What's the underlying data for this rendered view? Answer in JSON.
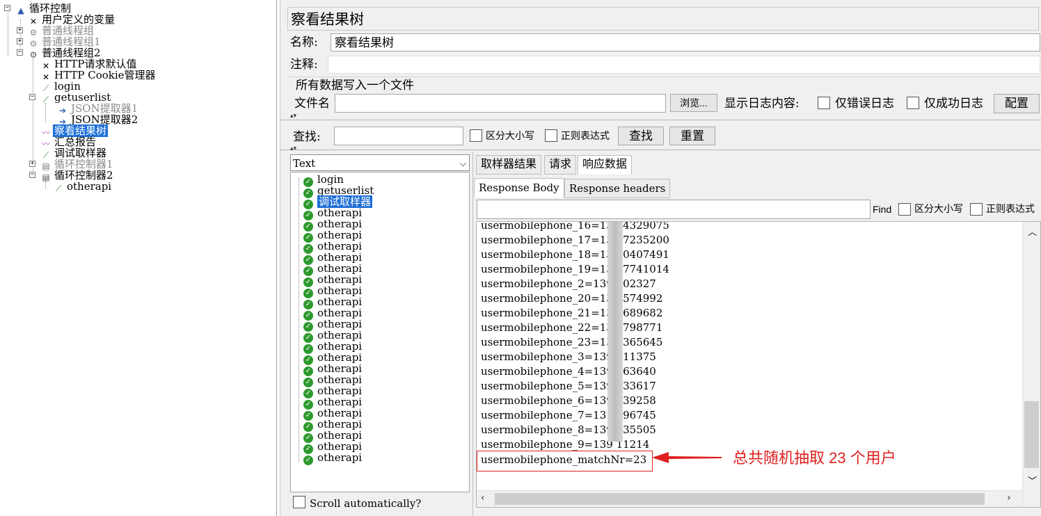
{
  "tree": {
    "root": "循环控制",
    "items": [
      {
        "label": "用户定义的变量",
        "icon": "wrench-icon"
      },
      {
        "label": "普通线程组",
        "icon": "gear-icon"
      },
      {
        "label": "普通线程组1",
        "icon": "gear-icon"
      },
      {
        "label": "普通线程组2",
        "icon": "gear-icon"
      },
      {
        "label": "HTTP请求默认值",
        "icon": "wrench-icon"
      },
      {
        "label": "HTTP Cookie管理器",
        "icon": "wrench-icon"
      },
      {
        "label": "login",
        "icon": "pipette-icon"
      },
      {
        "label": "getuserlist",
        "icon": "pipette-icon"
      },
      {
        "label": "JSON提取器1",
        "icon": "arrow-icon"
      },
      {
        "label": "JSON提取器2",
        "icon": "arrow-icon"
      },
      {
        "label": "察看结果树",
        "icon": "graph-icon"
      },
      {
        "label": "汇总报告",
        "icon": "graph-icon"
      },
      {
        "label": "调试取样器",
        "icon": "pipette-icon"
      },
      {
        "label": "循环控制器1",
        "icon": "loop-icon"
      },
      {
        "label": "循环控制器2",
        "icon": "loop-icon"
      },
      {
        "label": "otherapi",
        "icon": "pipette-icon"
      }
    ]
  },
  "panel": {
    "title": "察看结果树",
    "name_label": "名称:",
    "name_value": "察看结果树",
    "comment_label": "注释:",
    "comment_value": "",
    "file_section": "所有数据写入一个文件",
    "filename_label": "文件名",
    "filename_value": "",
    "browse": "浏览...",
    "log_label": "显示日志内容:",
    "errors_only": "仅错误日志",
    "success_only": "仅成功日志",
    "configure": "配置"
  },
  "search": {
    "label": "查找:",
    "value": "",
    "case_sensitive": "区分大小写",
    "regex": "正则表达式",
    "find_btn": "查找",
    "reset_btn": "重置"
  },
  "renderer": {
    "selected": "Text"
  },
  "results": {
    "items": [
      "login",
      "getuserlist",
      "调试取样器",
      "otherapi",
      "otherapi",
      "otherapi",
      "otherapi",
      "otherapi",
      "otherapi",
      "otherapi",
      "otherapi",
      "otherapi",
      "otherapi",
      "otherapi",
      "otherapi",
      "otherapi",
      "otherapi",
      "otherapi",
      "otherapi",
      "otherapi",
      "otherapi",
      "otherapi",
      "otherapi",
      "otherapi",
      "otherapi",
      "otherapi"
    ],
    "scroll_auto": "Scroll automatically?"
  },
  "tabs": [
    "取样器结果",
    "请求",
    "响应数据"
  ],
  "subtabs": [
    "Response Body",
    "Response headers"
  ],
  "find": {
    "label": "Find",
    "value": "",
    "case_sensitive": "区分大小写",
    "regex": "正则表达式"
  },
  "response_lines": [
    "usermobilephone_16=139  4329075",
    "usermobilephone_17=139  7235200",
    "usermobilephone_18=139  0407491",
    "usermobilephone_19=139  7741014",
    "usermobilephone_2=139  902327",
    "usermobilephone_20=139  574992",
    "usermobilephone_21=139  689682",
    "usermobilephone_22=139  798771",
    "usermobilephone_23=139  365645",
    "usermobilephone_3=139  111375",
    "usermobilephone_4=139  263640",
    "usermobilephone_5=139  333617",
    "usermobilephone_6=139  639258",
    "usermobilephone_7=13  5596745",
    "usermobilephone_8=139  435505",
    "usermobilephone_9=139  11214",
    "usermobilephone_matchNr=23"
  ],
  "annotation": "总共随机抽取 23 个用户",
  "colors": {
    "selection": "#1e6fd6",
    "annotation": "#e0201f",
    "success": "#2e9a2e"
  }
}
